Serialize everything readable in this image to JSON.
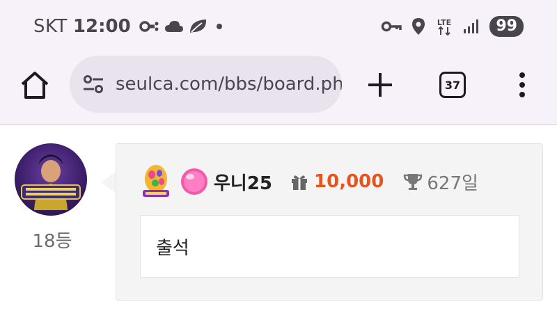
{
  "status_bar": {
    "carrier": "SKT",
    "time": "12:00",
    "network": "LTE",
    "battery": "99",
    "icons_left": [
      "link-icon",
      "cloud-icon",
      "leaf-icon",
      "dot-icon"
    ],
    "icons_right": [
      "vpn-key-icon",
      "location-icon",
      "lte-icon",
      "signal-icon",
      "battery-icon"
    ]
  },
  "browser": {
    "url": "seulca.com/bbs/board.ph",
    "tab_count": "37",
    "icons": [
      "home-icon",
      "site-settings-icon",
      "plus-icon",
      "tabs-icon",
      "more-vert-icon"
    ]
  },
  "comment": {
    "rank": "18등",
    "username": "우니25",
    "points": "10,000",
    "days": "627일",
    "text": "출석",
    "icons": [
      "avatar",
      "egg-badge-icon",
      "level-orb-icon",
      "gift-icon",
      "trophy-icon"
    ]
  },
  "colors": {
    "chrome_bg": "#f7f2fa",
    "url_bar_bg": "#e8e3ec",
    "points_color": "#e8541c",
    "card_bg": "#f4f4f4"
  }
}
